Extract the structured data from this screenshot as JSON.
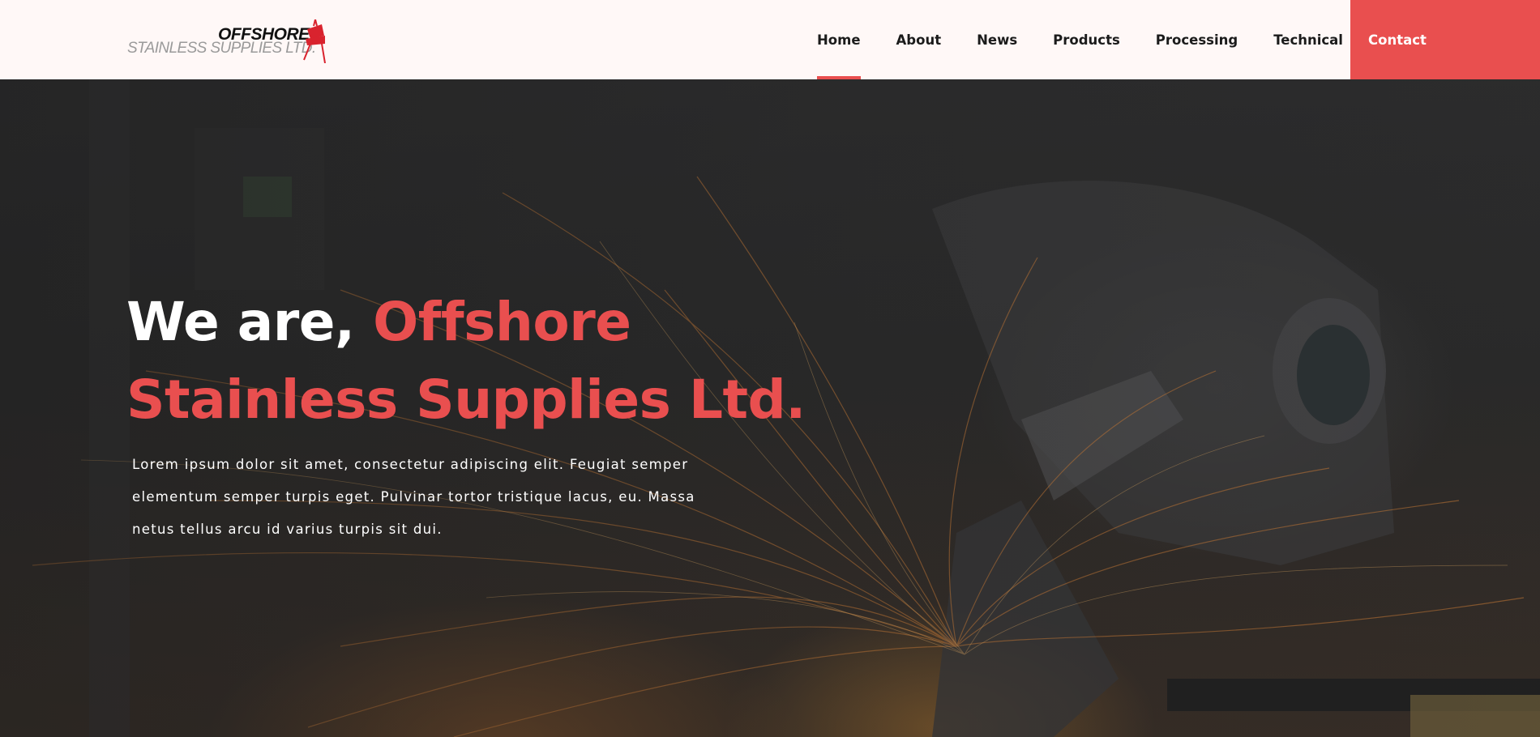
{
  "brand": {
    "name_top": "OFFSHORE",
    "name_bottom": "STAINLESS SUPPLIES LTD.",
    "accent_color": "#e94f4f",
    "logo_icon": "hoist-crane-icon"
  },
  "nav": {
    "items": [
      {
        "label": "Home",
        "active": true
      },
      {
        "label": "About",
        "active": false
      },
      {
        "label": "News",
        "active": false
      },
      {
        "label": "Products",
        "active": false
      },
      {
        "label": "Processing",
        "active": false
      },
      {
        "label": "Technical",
        "active": false
      }
    ],
    "contact_label": "Contact"
  },
  "hero": {
    "title_white": "We are, ",
    "title_accent_1": "Offshore",
    "title_accent_2": "Stainless Supplies Ltd.",
    "description": "Lorem ipsum dolor sit amet, consectetur adipiscing elit. Feugiat semper elementum semper turpis eget. Pulvinar tortor tristique lacus, eu. Massa netus tellus arcu id varius turpis sit dui."
  },
  "colors": {
    "accent": "#e94f4f",
    "header_bg": "#fff8f7",
    "nav_text": "#1b1b1b",
    "hero_text": "#ffffff"
  }
}
